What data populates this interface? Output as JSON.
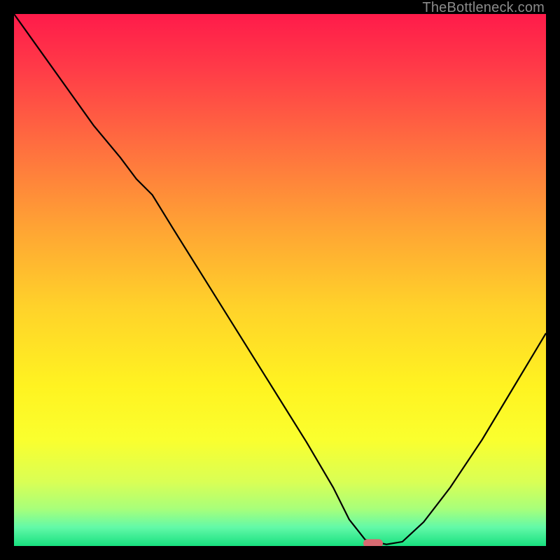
{
  "watermark": "TheBottleneck.com",
  "chart_data": {
    "type": "line",
    "title": "",
    "xlabel": "",
    "ylabel": "",
    "xlim": [
      0,
      100
    ],
    "ylim": [
      0,
      100
    ],
    "background_gradient": {
      "stops": [
        {
          "offset": 0.0,
          "color": "#ff1b4a"
        },
        {
          "offset": 0.1,
          "color": "#ff3a48"
        },
        {
          "offset": 0.25,
          "color": "#ff6f3f"
        },
        {
          "offset": 0.4,
          "color": "#ffa334"
        },
        {
          "offset": 0.55,
          "color": "#ffd22a"
        },
        {
          "offset": 0.7,
          "color": "#fff321"
        },
        {
          "offset": 0.8,
          "color": "#faff2e"
        },
        {
          "offset": 0.88,
          "color": "#d9ff55"
        },
        {
          "offset": 0.93,
          "color": "#a8ff7a"
        },
        {
          "offset": 0.965,
          "color": "#62f9a8"
        },
        {
          "offset": 1.0,
          "color": "#18e07f"
        }
      ]
    },
    "marker": {
      "x": 67.5,
      "y": 0.5,
      "color": "#d86b72"
    },
    "series": [
      {
        "name": "bottleneck-curve",
        "color": "#000000",
        "x": [
          0.0,
          5,
          10,
          15,
          20,
          23,
          26,
          30,
          35,
          40,
          45,
          50,
          55,
          60,
          63,
          66,
          70,
          73,
          77,
          82,
          88,
          94,
          100
        ],
        "y": [
          100,
          93,
          86,
          79,
          73,
          69,
          66,
          59.5,
          51.5,
          43.5,
          35.5,
          27.5,
          19.5,
          11,
          5,
          1.2,
          0.3,
          0.8,
          4.5,
          11,
          20,
          30,
          40
        ]
      }
    ]
  }
}
